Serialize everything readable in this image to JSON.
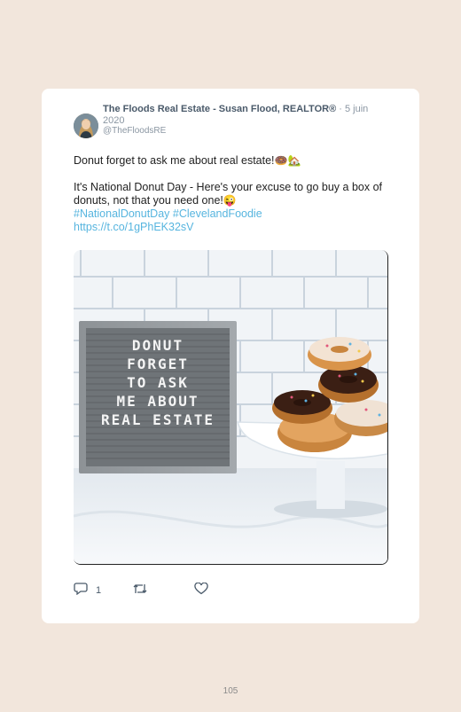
{
  "tweet": {
    "author": "The Floods Real Estate - Susan Flood, REALTOR®",
    "separator": "·",
    "date": "5 juin 2020",
    "handle": "@TheFloodsRE",
    "line1": "Donut forget to ask me about real estate!",
    "line1_emojis": "🍩🏡",
    "line2": "It's National Donut Day - Here's your excuse to go buy a box of donuts, not that you need one!",
    "line2_emoji": "😜",
    "hashtag1": "#NationalDonutDay",
    "hashtag2": "#ClevelandFoodie",
    "link": "https://t.co/1gPhEK32sV"
  },
  "media": {
    "letterboard_lines": [
      "DONUT",
      "FORGET",
      "TO ASK",
      "ME ABOUT",
      "REAL ESTATE"
    ]
  },
  "actions": {
    "reply_count": "1",
    "icons": [
      "reply-icon",
      "retweet-icon",
      "like-icon"
    ]
  },
  "page_number": "105"
}
